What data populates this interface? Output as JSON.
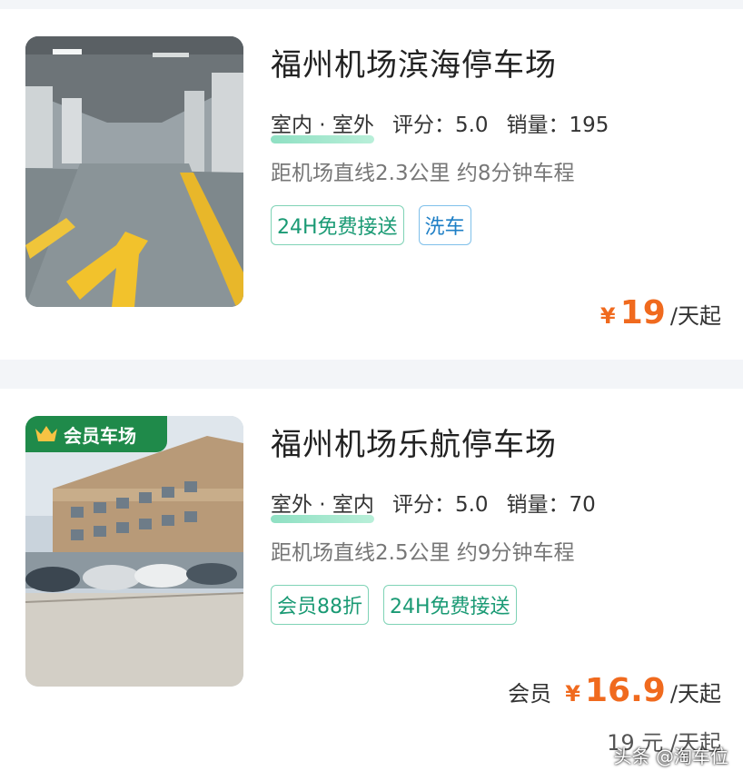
{
  "listings": [
    {
      "title": "福州机场滨海停车场",
      "type": "室内 · 室外",
      "rating": "评分：5.0",
      "sales": "销量：195",
      "distance": "距机场直线2.3公里 约8分钟车程",
      "tags": [
        "24H免费接送",
        "洗车"
      ],
      "price_symbol": "¥",
      "price": "19",
      "price_unit": "/天起"
    },
    {
      "badge": "会员车场",
      "title": "福州机场乐航停车场",
      "type": "室外 · 室内",
      "rating": "评分：5.0",
      "sales": "销量：70",
      "distance": "距机场直线2.5公里 约9分钟车程",
      "tags": [
        "会员88折",
        "24H免费接送"
      ],
      "member_label": "会员",
      "price_symbol": "¥",
      "price": "16.9",
      "price_unit": "/天起",
      "original_price": "19 元 /天起"
    }
  ],
  "watermark": "头条 @淘车位",
  "colors": {
    "accent": "#f06a1e",
    "tag_green": "#1a9a74",
    "tag_blue": "#1e7fc6",
    "badge_bg": "#1f8a4a"
  }
}
